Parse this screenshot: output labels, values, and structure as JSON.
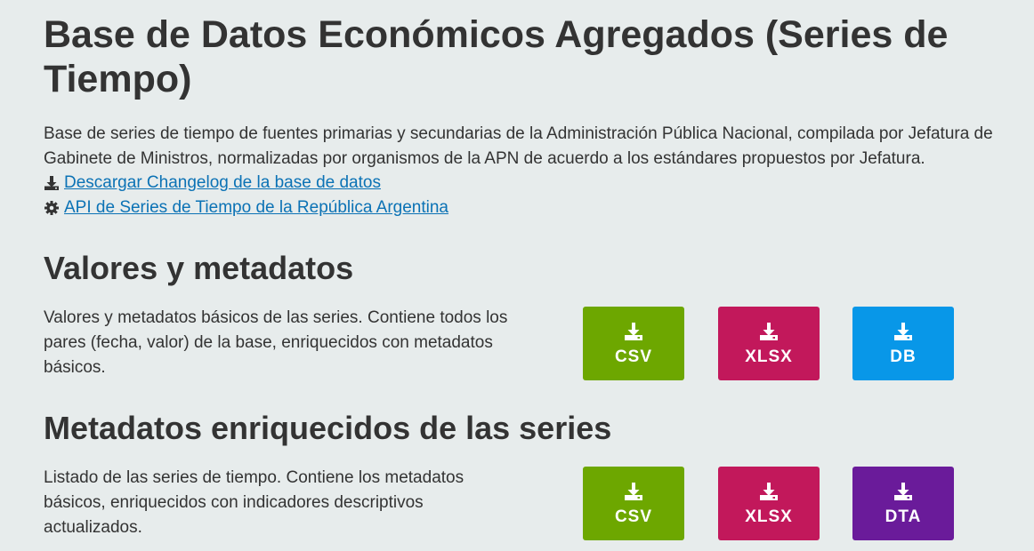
{
  "header": {
    "title": "Base de Datos Económicos Agregados (Series de Tiempo)",
    "description": "Base de series de tiempo de fuentes primarias y secundarias de la Administración Pública Nacional, compilada por Jefatura de Gabinete de Ministros, normalizadas por organismos de la APN de acuerdo a los estándares propuestos por Jefatura."
  },
  "links": {
    "changelog": "Descargar Changelog de la base de datos",
    "api": "API de Series de Tiempo de la República Argentina"
  },
  "sections": [
    {
      "title": "Valores y metadatos",
      "description": "Valores y metadatos básicos de las series. Contiene todos los pares (fecha, valor) de la base, enriquecidos con metadatos básicos.",
      "buttons": [
        {
          "label": "CSV",
          "color": "#6da700",
          "icon": "download-icon"
        },
        {
          "label": "XLSX",
          "color": "#c2185b",
          "icon": "download-icon"
        },
        {
          "label": "DB",
          "color": "#0897e8",
          "icon": "download-icon"
        }
      ]
    },
    {
      "title": "Metadatos enriquecidos de las series",
      "description": "Listado de las series de tiempo. Contiene los metadatos básicos, enriquecidos con indicadores descriptivos actualizados.",
      "buttons": [
        {
          "label": "CSV",
          "color": "#6da700",
          "icon": "download-icon"
        },
        {
          "label": "XLSX",
          "color": "#c2185b",
          "icon": "download-icon"
        },
        {
          "label": "DTA",
          "color": "#6a1b9a",
          "icon": "download-icon"
        }
      ]
    }
  ],
  "colors": {
    "background": "#e7ecec",
    "text": "#333333",
    "link": "#0b72b5"
  }
}
